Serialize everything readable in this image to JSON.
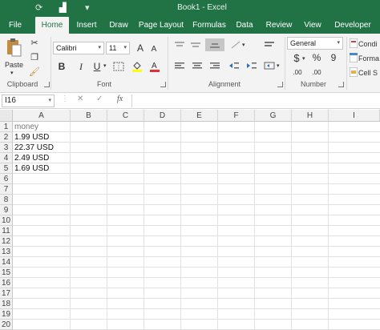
{
  "titlebar": {
    "window_title": "Book1  -  Excel"
  },
  "tabs": [
    "File",
    "Home",
    "Insert",
    "Draw",
    "Page Layout",
    "Formulas",
    "Data",
    "Review",
    "View",
    "Developer"
  ],
  "ribbon": {
    "clipboard": {
      "paste": "Paste",
      "label": "Clipboard"
    },
    "font": {
      "name": "Calibri",
      "size": "11",
      "label": "Font",
      "bold": "B",
      "italic": "I",
      "underline": "U",
      "grow": "A",
      "shrink": "A"
    },
    "alignment": {
      "label": "Alignment"
    },
    "number": {
      "format": "General",
      "label": "Number",
      "currency": "$",
      "percent": "%",
      "comma": "9",
      "inc_decimal": ".00",
      "dec_decimal": ".00"
    },
    "styles": {
      "conditional": "Condi",
      "format_table": "Forma",
      "cell_styles": "Cell S"
    }
  },
  "formula_bar": {
    "name_box": "I16",
    "fx": "fx",
    "value": ""
  },
  "grid": {
    "columns": [
      "A",
      "B",
      "C",
      "D",
      "E",
      "F",
      "G",
      "H",
      "I"
    ],
    "rows": [
      "1",
      "2",
      "3",
      "4",
      "5",
      "6",
      "7",
      "8",
      "9",
      "10",
      "11",
      "12",
      "13",
      "14",
      "15",
      "16",
      "17",
      "18",
      "19",
      "20"
    ],
    "cells_A": [
      "money",
      "1.99 USD",
      "22.37 USD",
      "2.49 USD",
      "1.69 USD"
    ]
  }
}
